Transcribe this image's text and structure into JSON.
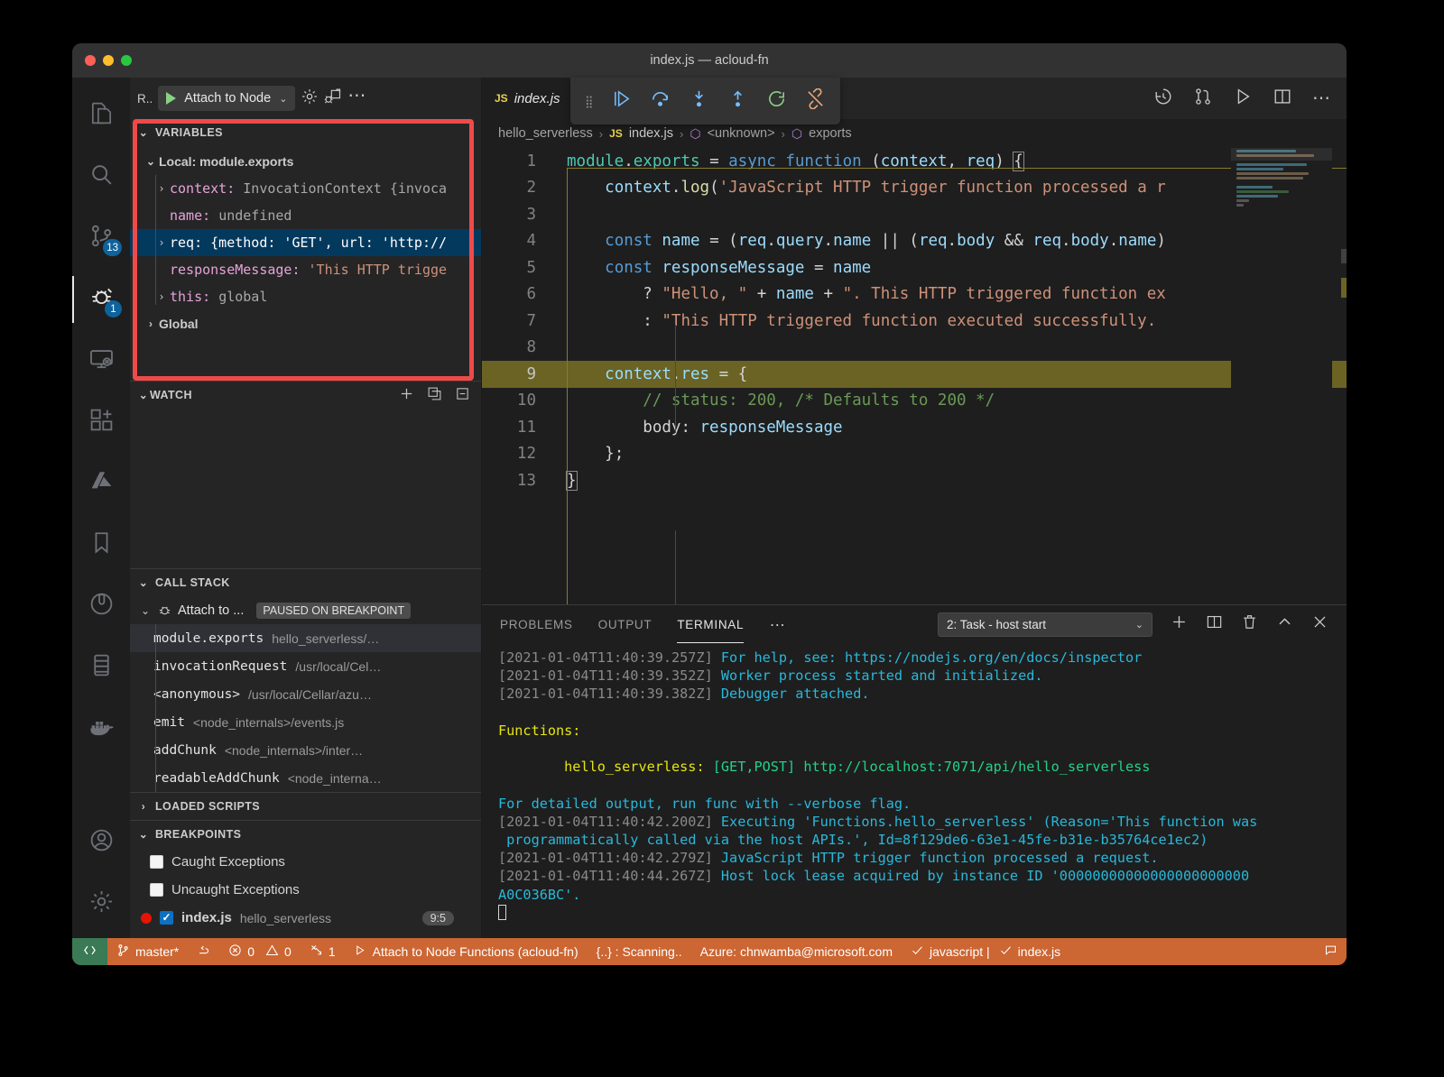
{
  "window": {
    "title": "index.js — acloud-fn"
  },
  "activitybar": {
    "items": [
      {
        "name": "explorer",
        "icon": "files-icon",
        "badge": ""
      },
      {
        "name": "search",
        "icon": "search-icon",
        "badge": ""
      },
      {
        "name": "source-control",
        "icon": "source-control-icon",
        "badge": "13"
      },
      {
        "name": "run-and-debug",
        "icon": "debug-icon",
        "badge": "1"
      },
      {
        "name": "remote-explorer",
        "icon": "remote-icon",
        "badge": ""
      },
      {
        "name": "extensions",
        "icon": "extensions-icon",
        "badge": ""
      },
      {
        "name": "azure",
        "icon": "azure-icon",
        "badge": ""
      },
      {
        "name": "bookmarks",
        "icon": "bookmark-icon",
        "badge": ""
      },
      {
        "name": "test",
        "icon": "beaker-icon",
        "badge": ""
      },
      {
        "name": "database",
        "icon": "database-icon",
        "badge": ""
      },
      {
        "name": "docker",
        "icon": "docker-icon",
        "badge": ""
      }
    ],
    "bottom": [
      {
        "name": "accounts",
        "icon": "account-icon"
      },
      {
        "name": "settings",
        "icon": "gear-icon"
      }
    ]
  },
  "debug_toolbar": {
    "run_label": "R..",
    "configuration": "Attach to Node",
    "gear_icon": "gear-icon",
    "debug_console_icon": "debug-console-icon",
    "more_icon": "ellipsis-icon"
  },
  "variables": {
    "title": "VARIABLES",
    "scopes": [
      {
        "label": "Local: module.exports",
        "expanded": true
      },
      {
        "label": "Global",
        "expanded": false
      }
    ],
    "rows": [
      {
        "arrow": "›",
        "name": "context:",
        "value": "InvocationContext {invoca",
        "kind": "obj",
        "selected": false
      },
      {
        "arrow": "",
        "name": "name:",
        "value": "undefined",
        "kind": "obj",
        "selected": false
      },
      {
        "arrow": "›",
        "name": "req:",
        "value": "{method: 'GET', url: 'http://",
        "kind": "sel",
        "selected": true
      },
      {
        "arrow": "",
        "name": "responseMessage:",
        "value": "'This HTTP trigge",
        "kind": "str",
        "selected": false
      },
      {
        "arrow": "›",
        "name": "this:",
        "value": "global",
        "kind": "obj",
        "selected": false
      }
    ]
  },
  "watch": {
    "title": "WATCH",
    "actions": [
      "add-expression-icon",
      "collapse-all-icon",
      "remove-all-icon"
    ]
  },
  "callstack": {
    "title": "CALL STACK",
    "session": "Attach to ...",
    "status": "PAUSED ON BREAKPOINT",
    "frames": [
      {
        "fn": "module.exports",
        "path": "hello_serverless/…",
        "selected": true
      },
      {
        "fn": "invocationRequest",
        "path": "/usr/local/Cel…",
        "selected": false
      },
      {
        "fn": "<anonymous>",
        "path": "/usr/local/Cellar/azu…",
        "selected": false
      },
      {
        "fn": "emit",
        "path": "<node_internals>/events.js",
        "selected": false
      },
      {
        "fn": "addChunk",
        "path": "<node_internals>/inter…",
        "selected": false
      },
      {
        "fn": "readableAddChunk",
        "path": "<node_interna…",
        "selected": false
      }
    ]
  },
  "loaded_scripts": {
    "title": "LOADED SCRIPTS"
  },
  "breakpoints": {
    "title": "BREAKPOINTS",
    "items": [
      {
        "label": "Caught Exceptions",
        "checked": false,
        "type": "exception"
      },
      {
        "label": "Uncaught Exceptions",
        "checked": false,
        "type": "exception"
      },
      {
        "label": "index.js",
        "sub": "hello_serverless",
        "line": "9:5",
        "checked": true,
        "type": "file"
      }
    ]
  },
  "editor": {
    "tab": {
      "badge": "JS",
      "label": "index.js"
    },
    "debug_controls": [
      "grip-icon",
      "continue-icon",
      "step-over-icon",
      "step-into-icon",
      "step-out-icon",
      "restart-icon",
      "disconnect-icon"
    ],
    "tab_actions": [
      "timeline-icon",
      "compare-icon",
      "run-icon",
      "split-editor-icon",
      "ellipsis-icon"
    ],
    "breadcrumb": [
      "hello_serverless",
      "index.js",
      "<unknown>",
      "exports"
    ],
    "current_line": 9,
    "lines": [
      {
        "n": 1,
        "text": "module.exports = async function (context, req) {"
      },
      {
        "n": 2,
        "text": "    context.log('JavaScript HTTP trigger function processed a r"
      },
      {
        "n": 3,
        "text": ""
      },
      {
        "n": 4,
        "text": "    const name = (req.query.name || (req.body && req.body.name)"
      },
      {
        "n": 5,
        "text": "    const responseMessage = name"
      },
      {
        "n": 6,
        "text": "        ? \"Hello, \" + name + \". This HTTP triggered function ex"
      },
      {
        "n": 7,
        "text": "        : \"This HTTP triggered function executed successfully."
      },
      {
        "n": 8,
        "text": ""
      },
      {
        "n": 9,
        "text": "    context.res = {"
      },
      {
        "n": 10,
        "text": "        // status: 200, /* Defaults to 200 */"
      },
      {
        "n": 11,
        "text": "        body: responseMessage"
      },
      {
        "n": 12,
        "text": "    };"
      },
      {
        "n": 13,
        "text": "}"
      }
    ]
  },
  "panel": {
    "tabs": [
      "PROBLEMS",
      "OUTPUT",
      "TERMINAL"
    ],
    "active_tab": "TERMINAL",
    "more_label": "…",
    "terminal_select": "2: Task - host start",
    "actions": [
      "new-terminal-icon",
      "split-terminal-icon",
      "kill-terminal-icon",
      "maximize-panel-icon",
      "close-panel-icon"
    ],
    "terminal_lines": [
      {
        "ts": "[2021-01-04T11:40:39.257Z]",
        "text": "For help, see: https://nodejs.org/en/docs/inspector",
        "color": "cyan"
      },
      {
        "ts": "[2021-01-04T11:40:39.352Z]",
        "text": "Worker process started and initialized.",
        "color": "cyan"
      },
      {
        "ts": "[2021-01-04T11:40:39.382Z]",
        "text": "Debugger attached.",
        "color": "cyan"
      },
      {
        "ts": "",
        "text": "",
        "color": "plain"
      },
      {
        "ts": "",
        "text": "Functions:",
        "color": "yellow"
      },
      {
        "ts": "",
        "text": "",
        "color": "plain"
      },
      {
        "ts": "",
        "text": "        hello_serverless: [GET,POST] http://localhost:7071/api/hello_serverless",
        "color": "func"
      },
      {
        "ts": "",
        "text": "",
        "color": "plain"
      },
      {
        "ts": "",
        "text": "For detailed output, run func with --verbose flag.",
        "color": "cyan"
      },
      {
        "ts": "[2021-01-04T11:40:42.200Z]",
        "text": "Executing 'Functions.hello_serverless' (Reason='This function was",
        "color": "cyan"
      },
      {
        "ts": "",
        "text": " programmatically called via the host APIs.', Id=8f129de6-63e1-45fe-b31e-b35764ce1ec2)",
        "color": "cyan"
      },
      {
        "ts": "[2021-01-04T11:40:42.279Z]",
        "text": "JavaScript HTTP trigger function processed a request.",
        "color": "cyan"
      },
      {
        "ts": "[2021-01-04T11:40:44.267Z]",
        "text": "Host lock lease acquired by instance ID '00000000000000000000000",
        "color": "cyan"
      },
      {
        "ts": "",
        "text": "A0C036BC'.",
        "color": "cyan"
      }
    ],
    "terminal_func_name": "hello_serverless:",
    "terminal_func_methods": "[GET,POST]",
    "terminal_func_url": "http://localhost:7071/api/hello_serverless"
  },
  "statusbar": {
    "remote_icon": "remote-indicator-icon",
    "branch": "master*",
    "sync_icon": "sync-icon",
    "errors": "0",
    "warnings": "0",
    "ports": "1",
    "debug_session": "Attach to Node Functions (acloud-fn)",
    "scanning": "{..} : Scanning..",
    "azure": "Azure: chnwamba@microsoft.com",
    "language": "javascript |",
    "file": "index.js",
    "feedback_icon": "feedback-icon"
  },
  "colors": {
    "accent_orange": "#cc6633",
    "selection_blue": "#04395e",
    "highlight_box": "#ef4a4a",
    "current_line": "#6a6324"
  }
}
